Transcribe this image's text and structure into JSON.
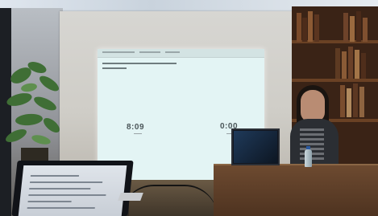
{
  "projection": {
    "heading_line1": "...",
    "heading_line2": "...",
    "timer_left": "8:09",
    "timer_right": "0:00"
  },
  "colors": {
    "projection_bg": "#e3f4f4",
    "podium_wood": "#6d4a30",
    "bookshelf": "#3a2316"
  },
  "icons": [
    "potted-plant-icon",
    "water-bottle-icon"
  ]
}
